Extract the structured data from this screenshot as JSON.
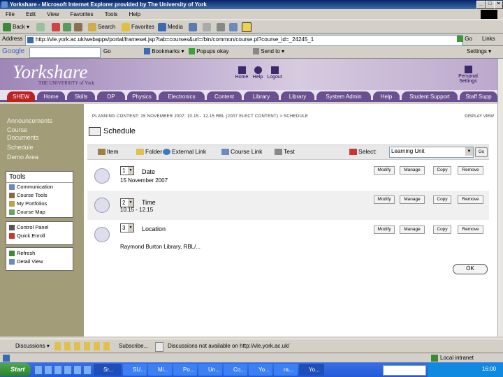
{
  "window": {
    "title": "Yorkshare - Microsoft Internet Explorer provided by The University of York"
  },
  "menu": [
    "File",
    "Edit",
    "View",
    "Favorites",
    "Tools",
    "Help"
  ],
  "toolbar": {
    "back": "Back",
    "search": "Search",
    "favorites": "Favorites",
    "media": "Media"
  },
  "address": {
    "label": "Address",
    "url": "http://vle.york.ac.uk/webapps/portal/frameset.jsp?tab=courses&url=/bin/common/course.pl?course_id=_24245_1",
    "go": "Go",
    "links": "Links"
  },
  "google": {
    "logo": "Google",
    "go": "Go",
    "bookmarks": "Bookmarks",
    "popups": "Popups okay",
    "sendto": "Send to",
    "settings": "Settings"
  },
  "header": {
    "logo": "Yorkshare",
    "logo_sub": "THE UNIVERSITY of York",
    "nav": [
      "Home",
      "Help",
      "Logout"
    ],
    "personal": "Personal Settings"
  },
  "tabs": [
    "SHEW",
    "Home",
    "Skills",
    "DP",
    "Physics",
    "Electronics",
    "Content",
    "Library",
    "Library",
    "System Admin",
    "Help",
    "Student Support",
    "Staff Supp"
  ],
  "leftnav": {
    "links": [
      "Announcements",
      "Course Documents",
      "Schedule",
      "Demo Area"
    ],
    "tools_header": "Tools",
    "tools": [
      "Communication",
      "Course Tools",
      "My Portfolios",
      "Course Map"
    ],
    "panel": [
      "Control Panel",
      "Quick Enroll"
    ],
    "view": [
      "Refresh",
      "Detail View"
    ]
  },
  "content": {
    "breadcrumb": "PLANNING CONTENT: 15 NOVEMBER 2007: 10.15 - 12.15 RBL (2007 ELECT CONTENT) > SCHEDULE",
    "display_view": "DISPLAY VIEW",
    "title": "Schedule",
    "actions": [
      "Item",
      "Folder",
      "External Link",
      "Course Link",
      "Test"
    ],
    "select_label": "Select:",
    "select_value": "Learning Unit",
    "go": "Go",
    "row_buttons": [
      "Modify",
      "Manage",
      "Copy",
      "Remove"
    ],
    "rows": [
      {
        "pos": "1",
        "title": "Date",
        "text": "15 November 2007"
      },
      {
        "pos": "2",
        "title": "Time",
        "text": "10.15 - 12.15"
      },
      {
        "pos": "3",
        "title": "Location",
        "text": "Raymond Burton Library, RBL/..."
      }
    ],
    "ok": "OK"
  },
  "bottom": {
    "discussions": "Discussions",
    "subscribe": "Subscribe...",
    "discussions_msg": "Discussions not available on http://vle.york.ac.uk/"
  },
  "status": {
    "zone": "Local intranet"
  },
  "taskbar": {
    "start": "Start",
    "items": [
      "Sr...",
      "SU...",
      "Mi...",
      "Po...",
      "Un...",
      "Co...",
      "Yo...",
      "ra...",
      "Yo..."
    ],
    "clock": "16:00"
  }
}
